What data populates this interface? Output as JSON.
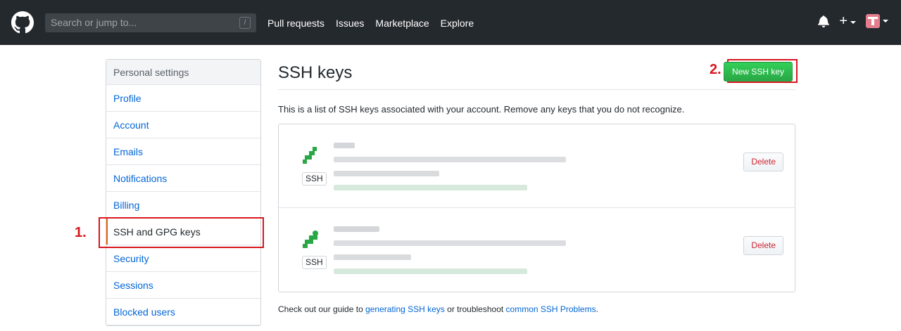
{
  "header": {
    "search_placeholder": "Search or jump to...",
    "search_shortcut": "/",
    "nav": [
      "Pull requests",
      "Issues",
      "Marketplace",
      "Explore"
    ],
    "plus_symbol": "+"
  },
  "sidebar": {
    "heading": "Personal settings",
    "items": [
      {
        "label": "Profile"
      },
      {
        "label": "Account"
      },
      {
        "label": "Emails"
      },
      {
        "label": "Notifications"
      },
      {
        "label": "Billing"
      },
      {
        "label": "SSH and GPG keys"
      },
      {
        "label": "Security"
      },
      {
        "label": "Sessions"
      },
      {
        "label": "Blocked users"
      }
    ]
  },
  "annotations": {
    "step1": "1.",
    "step2": "2."
  },
  "main": {
    "title": "SSH keys",
    "new_button": "New SSH key",
    "description": "This is a list of SSH keys associated with your account. Remove any keys that you do not recognize.",
    "keys": [
      {
        "tag": "SSH",
        "delete_label": "Delete",
        "icon_color": "#28a745"
      },
      {
        "tag": "SSH",
        "delete_label": "Delete",
        "icon_color": "#28a745"
      }
    ],
    "guide": {
      "prefix": "Check out our guide to ",
      "link1": "generating SSH keys",
      "middle": " or troubleshoot ",
      "link2": "common SSH Problems",
      "suffix": "."
    }
  },
  "colors": {
    "header_bg": "#24292e",
    "link": "#0366d6",
    "primary_button": "#28a745",
    "danger": "#cb2431",
    "annotation_red": "#d7161e"
  }
}
